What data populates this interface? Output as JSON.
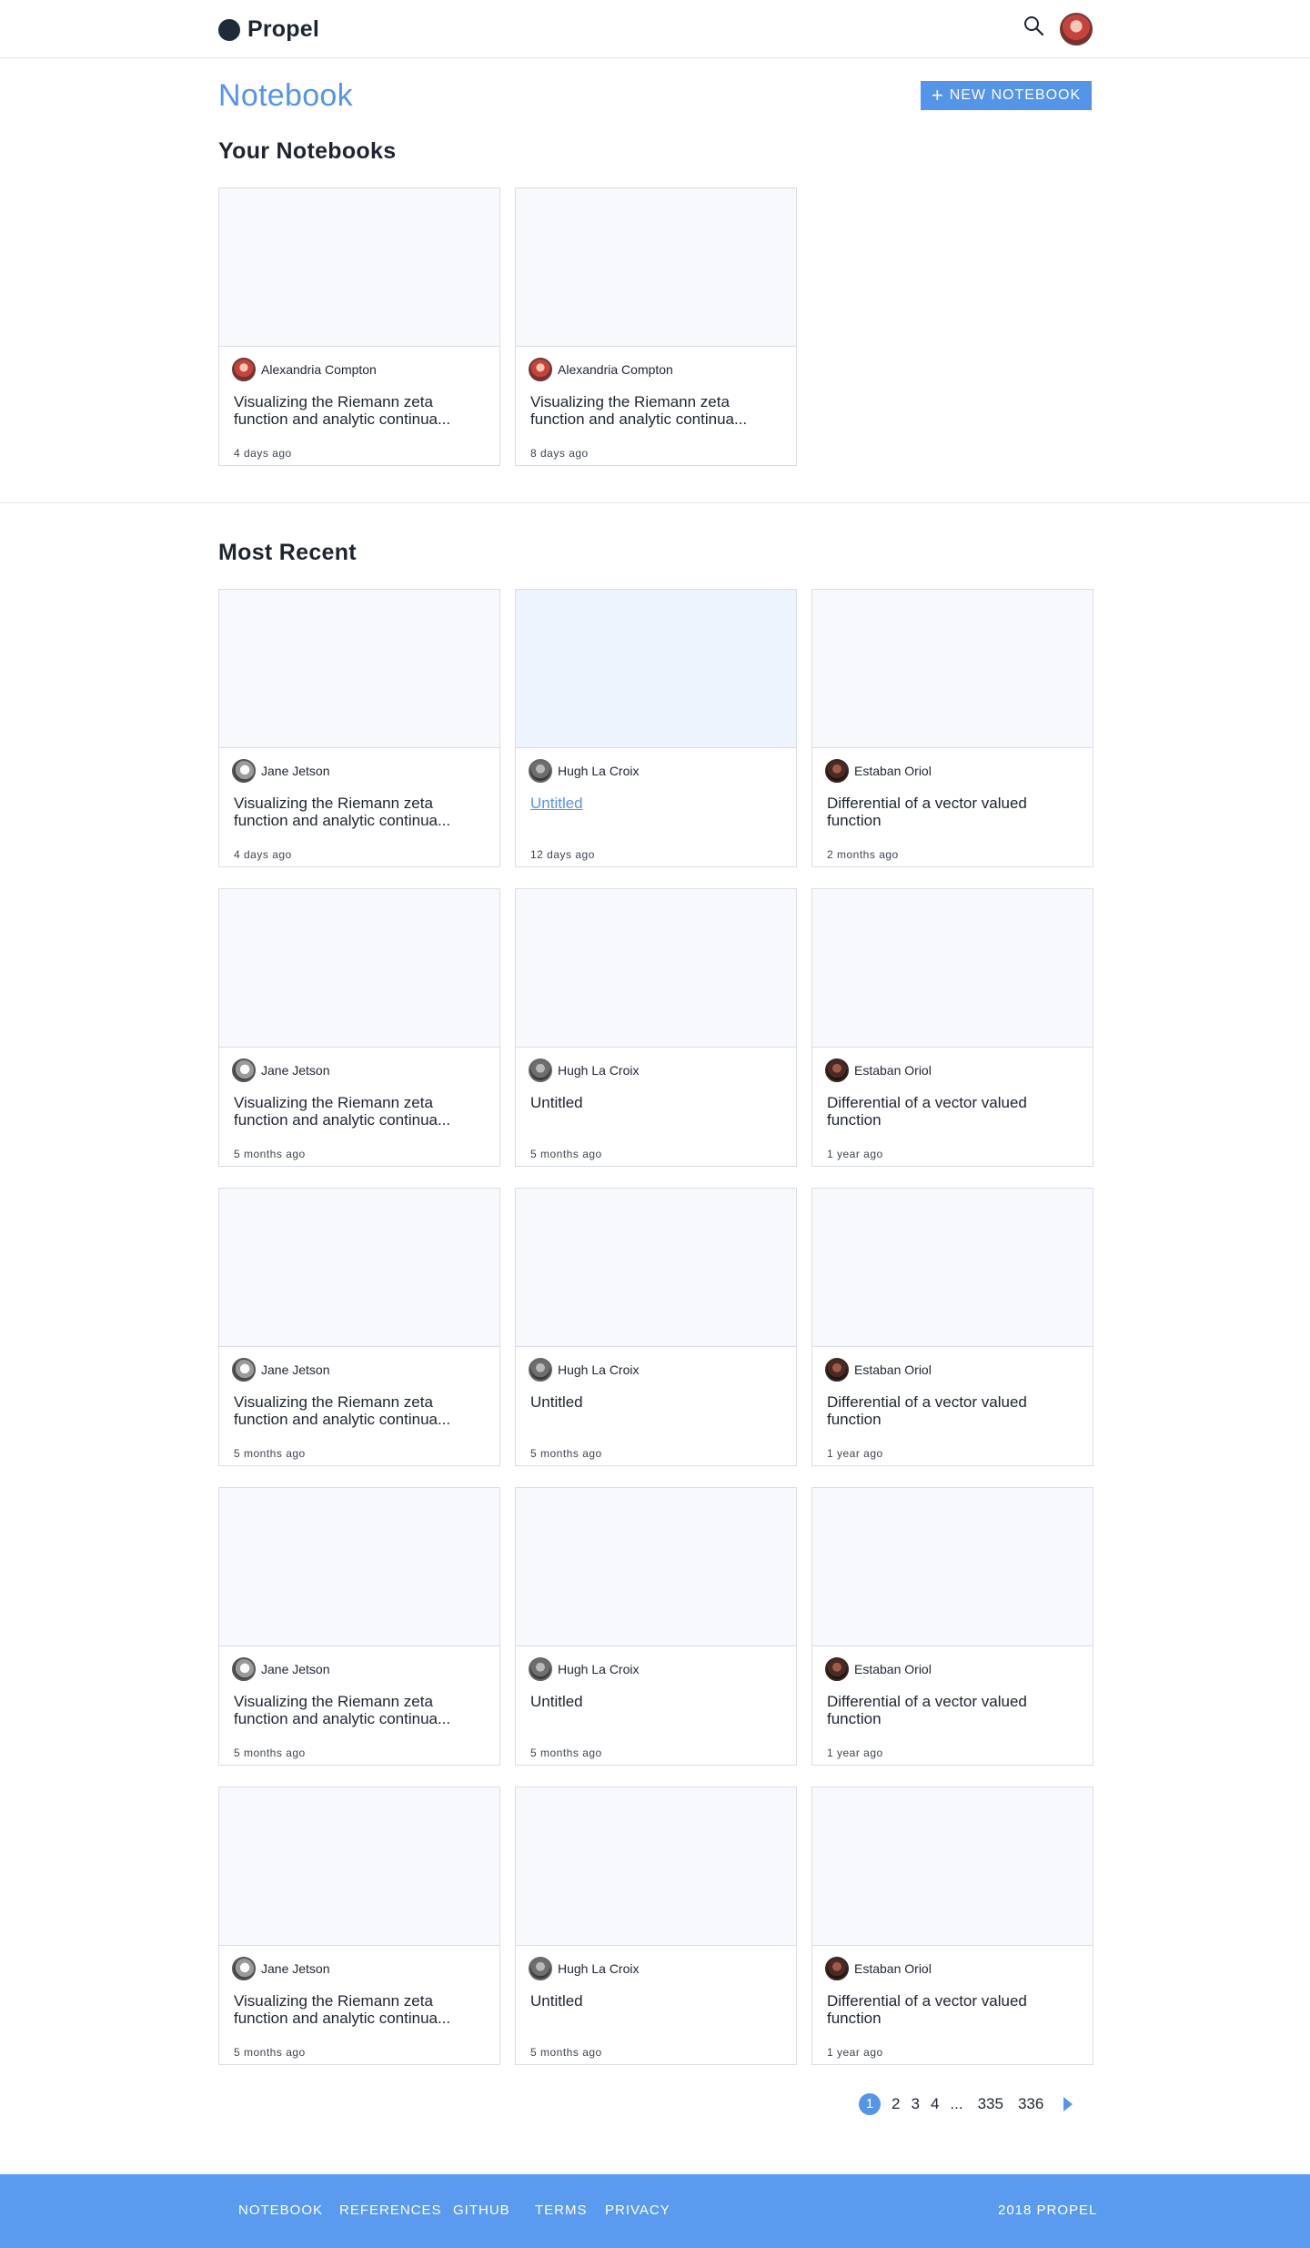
{
  "header": {
    "brand": "Propel",
    "search_icon": "search-icon",
    "avatar_icon": "user-avatar"
  },
  "page": {
    "title": "Notebook",
    "new_button": "NEW NOTEBOOK",
    "new_button_icon": "plus-icon"
  },
  "your_notebooks": {
    "title": "Your Notebooks",
    "cards": [
      {
        "author": "Alexandria Compton",
        "title": "Visualizing the Riemann zeta function and analytic continua...",
        "time": "4 days ago",
        "avatar": "alex"
      },
      {
        "author": "Alexandria Compton",
        "title": "Visualizing the Riemann zeta function and analytic continua...",
        "time": "8 days ago",
        "avatar": "alex"
      }
    ]
  },
  "most_recent": {
    "title": "Most Recent",
    "cards": [
      {
        "author": "Jane Jetson",
        "title": "Visualizing the Riemann zeta function and analytic continua...",
        "time": "4 days ago",
        "avatar": "jane"
      },
      {
        "author": "Hugh La Croix",
        "title": "Untitled",
        "time": "12 days ago",
        "avatar": "hugh",
        "hover": true
      },
      {
        "author": "Estaban Oriol",
        "title": "Differential of a vector valued function",
        "time": "2 months ago",
        "avatar": "esta"
      },
      {
        "author": "Jane Jetson",
        "title": "Visualizing the Riemann zeta function and analytic continua...",
        "time": "5 months ago",
        "avatar": "jane"
      },
      {
        "author": "Hugh La Croix",
        "title": "Untitled",
        "time": "5 months ago",
        "avatar": "hugh"
      },
      {
        "author": "Estaban Oriol",
        "title": "Differential of a vector valued function",
        "time": "1 year ago",
        "avatar": "esta"
      },
      {
        "author": "Jane Jetson",
        "title": "Visualizing the Riemann zeta function and analytic continua...",
        "time": "5 months ago",
        "avatar": "jane"
      },
      {
        "author": "Hugh La Croix",
        "title": "Untitled",
        "time": "5 months ago",
        "avatar": "hugh"
      },
      {
        "author": "Estaban Oriol",
        "title": "Differential of a vector valued function",
        "time": "1 year ago",
        "avatar": "esta"
      },
      {
        "author": "Jane Jetson",
        "title": "Visualizing the Riemann zeta function and analytic continua...",
        "time": "5 months ago",
        "avatar": "jane"
      },
      {
        "author": "Hugh La Croix",
        "title": "Untitled",
        "time": "5 months ago",
        "avatar": "hugh"
      },
      {
        "author": "Estaban Oriol",
        "title": "Differential of a vector valued function",
        "time": "1 year ago",
        "avatar": "esta"
      },
      {
        "author": "Jane Jetson",
        "title": "Visualizing the Riemann zeta function and analytic continua...",
        "time": "5 months ago",
        "avatar": "jane"
      },
      {
        "author": "Hugh La Croix",
        "title": "Untitled",
        "time": "5 months ago",
        "avatar": "hugh"
      },
      {
        "author": "Estaban Oriol",
        "title": "Differential of a vector valued function",
        "time": "1 year ago",
        "avatar": "esta"
      }
    ]
  },
  "pagination": {
    "pages": [
      "1",
      "2",
      "3",
      "4"
    ],
    "active": "1",
    "ellipsis": "...",
    "last_pages": [
      "335",
      "336"
    ],
    "next_icon": "chevron-right-icon"
  },
  "footer": {
    "links": [
      "NOTEBOOK",
      "REFERENCES",
      "GITHUB",
      "TERMS",
      "PRIVACY"
    ],
    "copyright": "2018 PROPEL"
  },
  "colors": {
    "accent": "#5495ea",
    "footer": "#5b9bef",
    "card_thumb": "#f8f9fc",
    "card_thumb_hover": "#edf4fd"
  }
}
